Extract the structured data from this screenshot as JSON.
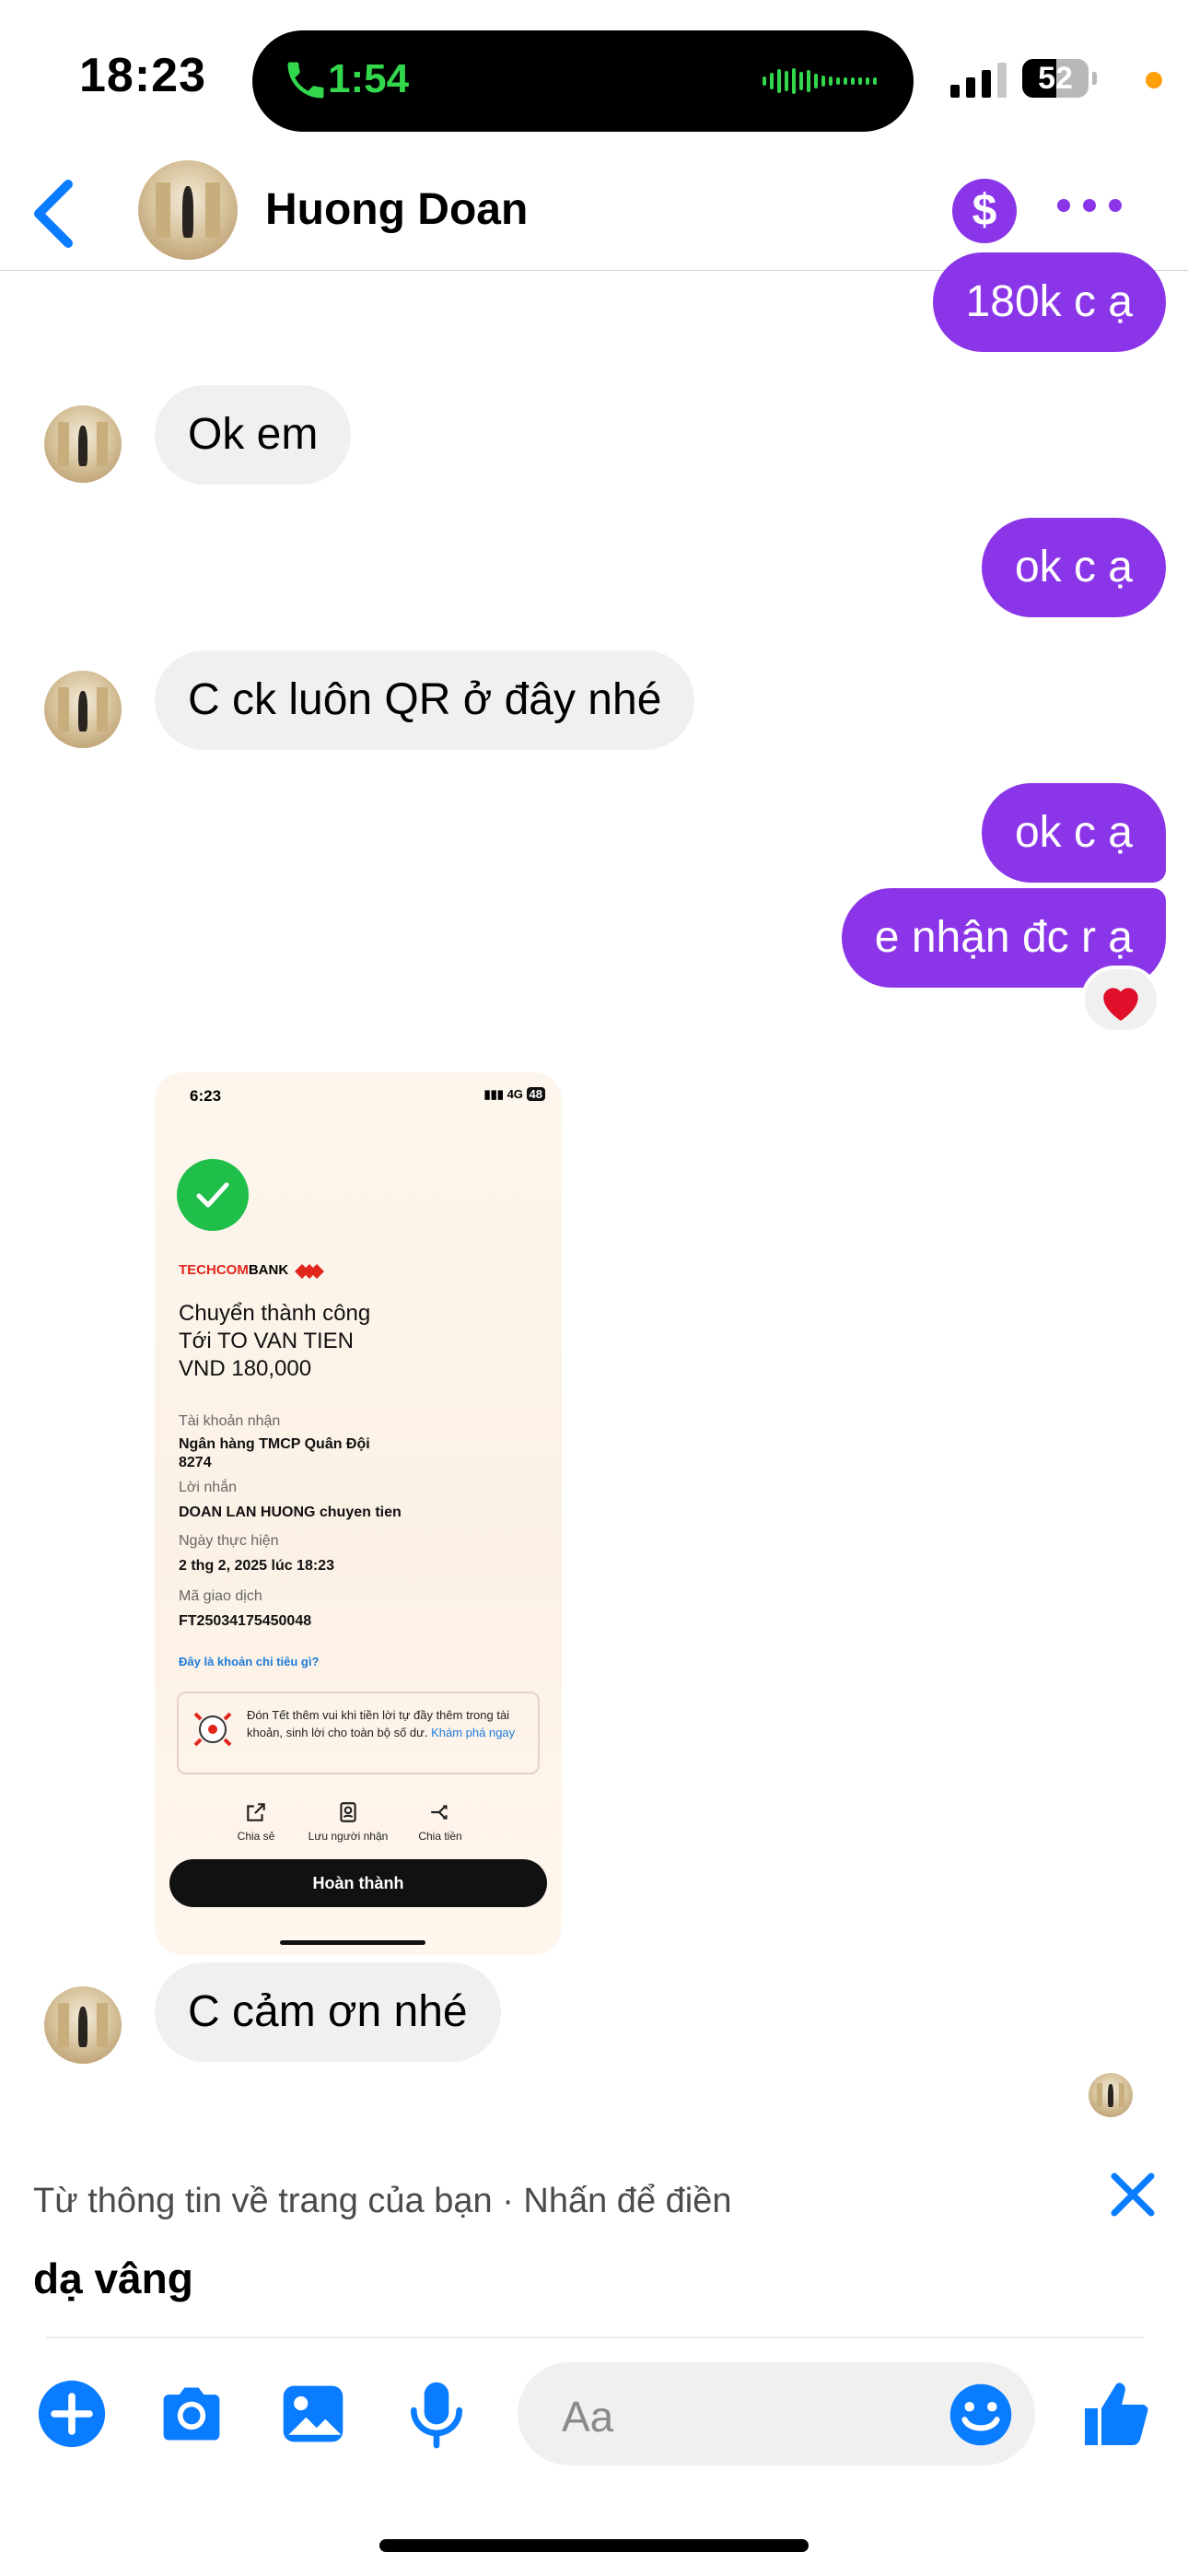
{
  "status_bar": {
    "time": "18:23",
    "call_duration": "1:54",
    "battery": "52",
    "battery_level_percent": 52,
    "signal_bars": 3,
    "call_icon": "phone-icon",
    "recording_dot_color": "#ff9f0a"
  },
  "header": {
    "contact_name": "Huong Doan",
    "back_icon": "chevron-left-icon",
    "payment_icon": "dollar-icon",
    "more_icon": "more-icon",
    "accent_color": "#8a36e8"
  },
  "messages": [
    {
      "direction": "out",
      "text": "180k c ạ"
    },
    {
      "direction": "in",
      "text": "Ok em"
    },
    {
      "direction": "out",
      "text": "ok c ạ"
    },
    {
      "direction": "in",
      "text": "C ck luôn QR ở đây nhé"
    },
    {
      "direction": "out",
      "text": "ok c ạ"
    },
    {
      "direction": "out",
      "text": "e nhận đc r ạ",
      "reaction": "❤️"
    },
    {
      "direction": "in",
      "type": "image"
    },
    {
      "direction": "in",
      "text": "C cảm ơn nhé"
    }
  ],
  "receipt": {
    "time": "6:23",
    "network": "4G",
    "battery": "48",
    "bank_prefix": "TECHCOM",
    "bank_suffix": "BANK",
    "title": "Chuyển thành công",
    "recipient": "Tới TO VAN TIEN",
    "amount": "VND 180,000",
    "account_label": "Tài khoản nhận",
    "account_bank": "Ngân hàng TMCP Quân Đội",
    "account_number": "8274",
    "message_label": "Lời nhắn",
    "message_value": "DOAN LAN HUONG chuyen tien",
    "date_label": "Ngày thực hiện",
    "date_value": "2 thg 2, 2025 lúc 18:23",
    "txn_label": "Mã giao dịch",
    "txn_value": "FT25034175450048",
    "link": "Đây là khoản chi tiêu gì?",
    "promo_text": "Đón Tết thêm vui khi tiền lời tự đầy thêm trong tài khoản, sinh lời cho toàn bộ số dư.",
    "promo_link": "Khám phá ngay",
    "actions": [
      "Chia sẻ",
      "Lưu người nhận",
      "Chia tiền"
    ],
    "done_button": "Hoàn thành"
  },
  "suggestion": {
    "hint": "Từ thông tin về trang của bạn · Nhấn để điền",
    "text": "dạ vâng",
    "close_icon": "close-icon"
  },
  "input": {
    "placeholder": "Aa",
    "icons": [
      "plus-icon",
      "camera-icon",
      "image-icon",
      "microphone-icon",
      "emoji-icon",
      "thumbs-up-icon"
    ],
    "icon_color": "#0a7cff"
  }
}
